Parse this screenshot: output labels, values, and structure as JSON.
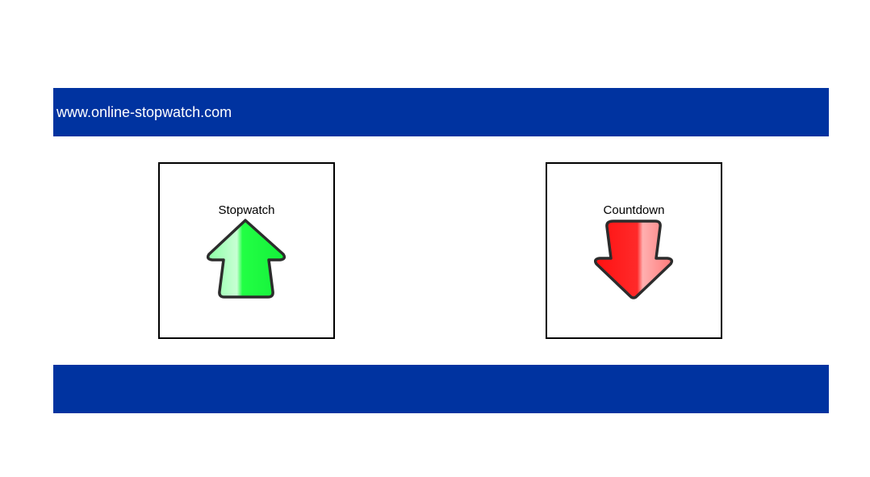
{
  "header": {
    "site_name": "www.online-stopwatch.com"
  },
  "tiles": [
    {
      "label": "Stopwatch",
      "icon": "up-arrow-icon",
      "color": "#22ff44"
    },
    {
      "label": "Countdown",
      "icon": "down-arrow-icon",
      "color": "#ff1111"
    }
  ],
  "colors": {
    "banner": "#0033a0",
    "tile_border": "#000000",
    "background": "#ffffff"
  }
}
